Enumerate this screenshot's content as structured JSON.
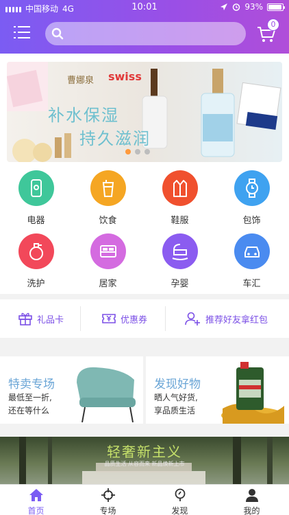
{
  "status_bar": {
    "carrier": "中国移动",
    "network": "4G",
    "time": "10:01",
    "battery": "93%"
  },
  "header": {
    "search_placeholder": "",
    "cart_count": "0"
  },
  "banner": {
    "brand": "曹娜泉",
    "brand_en": "swiss",
    "line1": "补水保湿",
    "line2": "持久滋润",
    "slides": 3,
    "active_slide": 0
  },
  "categories": [
    {
      "label": "电器",
      "icon": "phone-icon",
      "color": "#3fc79a"
    },
    {
      "label": "饮食",
      "icon": "drink-icon",
      "color": "#f5a623"
    },
    {
      "label": "鞋服",
      "icon": "clothing-icon",
      "color": "#f0502e"
    },
    {
      "label": "包饰",
      "icon": "watch-icon",
      "color": "#3fa2f0"
    },
    {
      "label": "洗护",
      "icon": "spray-bottle-icon",
      "color": "#f2485a"
    },
    {
      "label": "居家",
      "icon": "bed-icon",
      "color": "#d46be0"
    },
    {
      "label": "孕婴",
      "icon": "cradle-icon",
      "color": "#8b5cf0"
    },
    {
      "label": "车汇",
      "icon": "car-icon",
      "color": "#4a8bf0"
    }
  ],
  "quicklinks": [
    {
      "label": "礼品卡",
      "icon": "gift-icon"
    },
    {
      "label": "优惠券",
      "icon": "coupon-icon"
    },
    {
      "label": "推荐好友拿红包",
      "icon": "add-friend-icon"
    }
  ],
  "promos": [
    {
      "title": "特卖专场",
      "line1": "最低至一折,",
      "line2": "还在等什么"
    },
    {
      "title": "发现好物",
      "line1": "晒人气好货,",
      "line2": "享品质生活"
    }
  ],
  "bottom_banner": {
    "title": "轻奢新主义",
    "subtitle": "品质生活 从容而来 新品焕新上市"
  },
  "tabbar": [
    {
      "label": "首页",
      "icon": "home-icon",
      "active": true
    },
    {
      "label": "专场",
      "icon": "target-icon",
      "active": false
    },
    {
      "label": "发现",
      "icon": "discover-icon",
      "active": false
    },
    {
      "label": "我的",
      "icon": "user-icon",
      "active": false
    }
  ],
  "colors": {
    "accent": "#7b5cf3",
    "header_gradient_end": "#b04ed9",
    "promo_title": "#6aa5d6"
  }
}
